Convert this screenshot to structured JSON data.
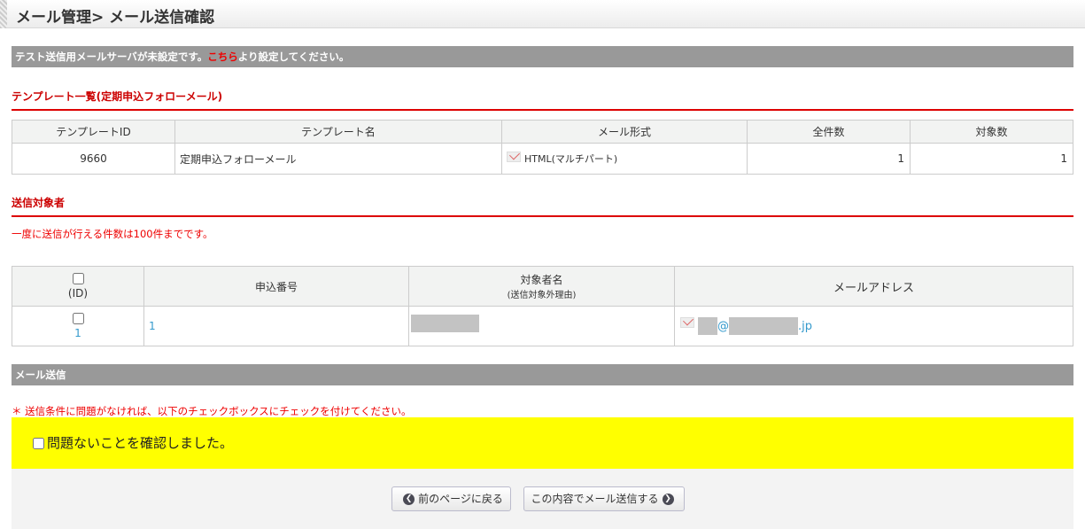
{
  "header": {
    "title": "メール管理> メール送信確認"
  },
  "notice": {
    "before": "テスト送信用メールサーバが未設定です。",
    "link": "こちら",
    "after": "より設定してください。"
  },
  "template_section": {
    "title": "テンプレート一覧(定期申込フォローメール)",
    "columns": [
      "テンプレートID",
      "テンプレート名",
      "メール形式",
      "全件数",
      "対象数"
    ],
    "row": {
      "id": "9660",
      "name": "定期申込フォローメール",
      "format": "HTML(マルチパート)",
      "total": "1",
      "target": "1"
    }
  },
  "recipient_section": {
    "title": "送信対象者",
    "note": "一度に送信が行える件数は100件までです。",
    "columns": {
      "id": "(ID)",
      "app_no": "申込番号",
      "name": "対象者名",
      "name_sub": "(送信対象外理由)",
      "email": "メールアドレス"
    },
    "rows": [
      {
        "id": "1",
        "app_no": "1",
        "email_at": "@",
        "email_tld": ".jp"
      }
    ]
  },
  "send_section": {
    "title": "メール送信",
    "note": "＊ 送信条件に問題がなければ、以下のチェックボックスにチェックを付けてください。",
    "confirm_label": "問題ないことを確認しました。"
  },
  "buttons": {
    "back": "前のページに戻る",
    "send": "この内容でメール送信する"
  }
}
